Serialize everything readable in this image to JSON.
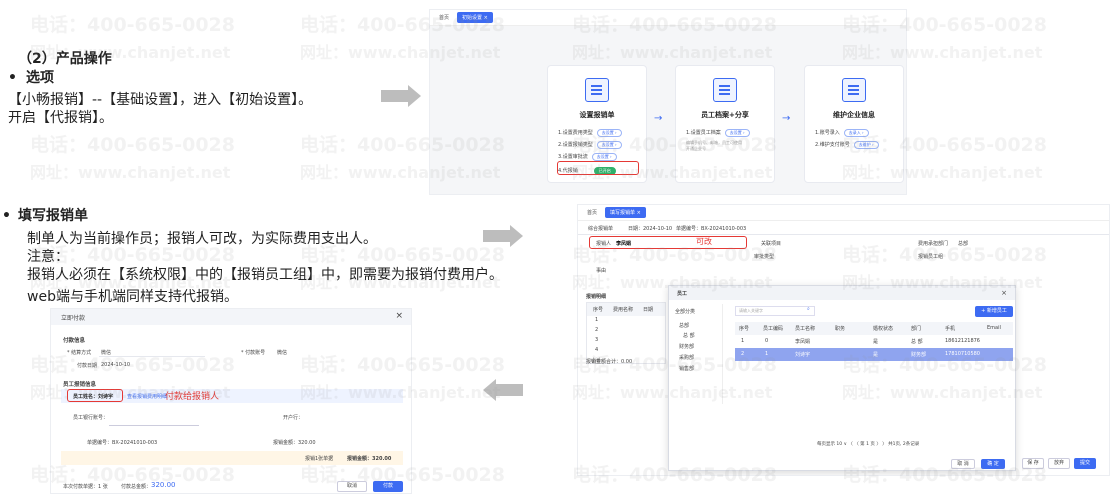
{
  "left_text": {
    "section2_title": "（2）产品操作",
    "bullet": "•",
    "option_title": "选项",
    "option_line1": "【小畅报销】--【基础设置】，进入【初始设置】。",
    "option_line2": "开启【代报销】。",
    "fill_title": "填写报销单",
    "fill_line1": "制单人为当前操作员；报销人可改，为实际费用支出人。",
    "fill_line2": "注意：",
    "fill_line3": "报销人必须在【系统权限】中的【报销员工组】中，即需要为报销付费用户。",
    "fill_line4": "web端与手机端同样支持代报销。"
  },
  "watermark": {
    "phone": "电话：400-665-0028",
    "site": "网址：www.chanjet.net"
  },
  "shot1": {
    "tab_home": "首页",
    "tab_init": "初始设置 ×",
    "card1": {
      "title": "设置报销单",
      "l1": "1.设置费用类型",
      "l2": "2.设置报销类型",
      "l3": "3.设置审批流",
      "l4": "4.代报销",
      "pill": "去设置 ›",
      "toggle": "已开启"
    },
    "card2": {
      "title": "员工档案+分享",
      "l1": "1.设置员工档案",
      "l2": "编辑手机号、邮箱，员工可使用",
      "l3": "开通企业号",
      "pill": "去设置 ›"
    },
    "card3": {
      "title": "维护企业信息",
      "l1": "1.账号录入",
      "l2": "2.维护支付账号",
      "pill1": "去录入 ›",
      "pill2": "去维护 ›"
    },
    "flow_arrow": "→"
  },
  "shot2": {
    "tab_home": "首页",
    "tab_active": "填写报销单 ×",
    "bar_items": [
      "综合报销单",
      "日期：2024-10-10",
      "单据编号：BX-20241010-003"
    ],
    "reporter_label": "报销人",
    "reporter_value": "李凤娟",
    "reporter_note": "可改",
    "expense_dept": "费用承担部门",
    "expense_dept_value": "总部",
    "related_project": "关联项目",
    "approval_type": "审批类型",
    "employee_group": "报销员工组",
    "reason": "事由",
    "detail_title": "报销明细",
    "detail_cols": [
      "序号",
      "费用名称",
      "日期"
    ],
    "detail_rows": [
      "1",
      "2",
      "3",
      "4",
      "小计"
    ],
    "total_text": "报销金额合计：0.00",
    "footer_btns": [
      "保 存",
      "放弃",
      "提交"
    ],
    "dialog": {
      "title": "员工",
      "search_placeholder": "请输入关键字",
      "new_btn": "+ 新增员工",
      "tree_root": "全部分类",
      "tree_items": [
        "总部",
        "总 部",
        "财务部",
        "采购部",
        "销售部"
      ],
      "cols": [
        "序号",
        "员工编码",
        "员工名称",
        "职务",
        "婚权状态",
        "部门",
        "手机",
        "Email"
      ],
      "rows": [
        [
          "1",
          "0",
          "李凤娟",
          "",
          "是",
          "总 部",
          "18612121876",
          ""
        ],
        [
          "2",
          "1",
          "刘诗宇",
          "",
          "是",
          "财务部",
          "17810710580",
          ""
        ]
      ],
      "pager": "每页显示 10 ∨   〈  〈  第 1 页  〉  〉  共1页, 2条记录",
      "cancel": "取 消",
      "ok": "确 定"
    }
  },
  "shot3": {
    "title": "立即付款",
    "close": "×",
    "section1": "付款信息",
    "pay_method_label": "* 结算方式",
    "pay_method_value": "微信",
    "pay_account_label": "* 付款账号",
    "pay_account_value": "微信",
    "pay_date_label": "付款日期",
    "pay_date_value": "2024-10-10",
    "section2": "员工报销信息",
    "employee_label": "员工姓名：刘诗宇",
    "employee_link": "查看报销费用明细",
    "annotation": "付款给报销人",
    "bank_label": "员工银行账号：",
    "bank_right": "开户行：",
    "bill_no": "单据编号：BX-20241010-003",
    "bill_amount": "报销金额：320.00",
    "summary_count": "报销1张单据",
    "summary_amount": "报销金额：320.00",
    "footer_left": "本次付款单据：1 张",
    "footer_total_label": "付款总金额：",
    "footer_total": "320.00",
    "cancel": "取消",
    "pay": "付款"
  }
}
